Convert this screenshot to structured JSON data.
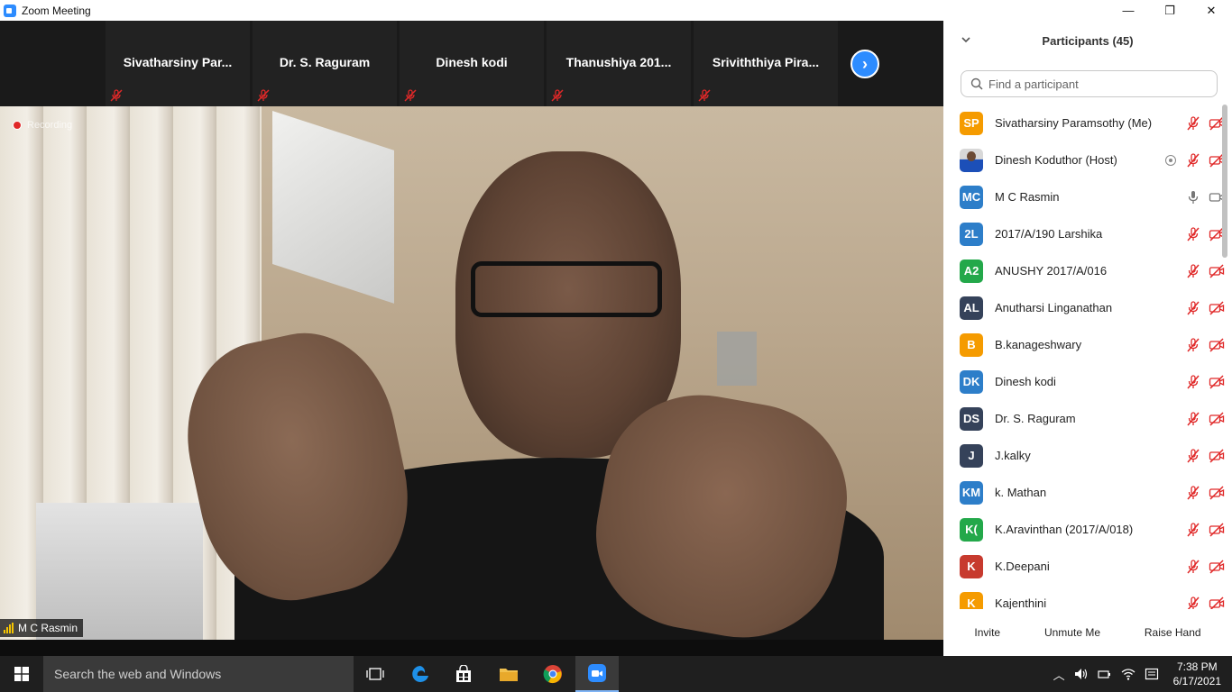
{
  "window": {
    "title": "Zoom Meeting",
    "minimize": "—",
    "maximize": "❐",
    "close": "✕"
  },
  "gallery": {
    "tiles": [
      {
        "name": "Sivatharsiny  Par..."
      },
      {
        "name": "Dr. S. Raguram"
      },
      {
        "name": "Dinesh kodi"
      },
      {
        "name": "Thanushiya  201..."
      },
      {
        "name": "Sriviththiya  Pira..."
      }
    ],
    "next_glyph": "›"
  },
  "main": {
    "recording_text": "Recording",
    "speaker_name": "M C Rasmin"
  },
  "panel": {
    "title": "Participants (45)",
    "search_placeholder": "Find a participant",
    "participants": [
      {
        "initials": "SP",
        "name": "Sivatharsiny Paramsothy (Me)",
        "color": "#f59b00",
        "mic": "muted",
        "video": "off"
      },
      {
        "initials": "",
        "name": "Dinesh Koduthor (Host)",
        "color": "photo",
        "mic": "muted",
        "video": "off",
        "host": true
      },
      {
        "initials": "MC",
        "name": "M C Rasmin",
        "color": "#2d7ec9",
        "mic": "on",
        "video": "on"
      },
      {
        "initials": "2L",
        "name": "2017/A/190 Larshika",
        "color": "#2d7ec9",
        "mic": "muted",
        "video": "off"
      },
      {
        "initials": "A2",
        "name": "ANUSHY 2017/A/016",
        "color": "#23a84a",
        "mic": "muted",
        "video": "off"
      },
      {
        "initials": "AL",
        "name": "Anutharsi Linganathan",
        "color": "#35425a",
        "mic": "muted",
        "video": "off"
      },
      {
        "initials": "B",
        "name": "B.kanageshwary",
        "color": "#f59b00",
        "mic": "muted",
        "video": "off"
      },
      {
        "initials": "DK",
        "name": "Dinesh kodi",
        "color": "#2d7ec9",
        "mic": "muted",
        "video": "off"
      },
      {
        "initials": "DS",
        "name": "Dr. S. Raguram",
        "color": "#35425a",
        "mic": "muted",
        "video": "off"
      },
      {
        "initials": "J",
        "name": "J.kalky",
        "color": "#35425a",
        "mic": "muted",
        "video": "off"
      },
      {
        "initials": "KM",
        "name": "k. Mathan",
        "color": "#2d7ec9",
        "mic": "muted",
        "video": "off"
      },
      {
        "initials": "K(",
        "name": "K.Aravinthan (2017/A/018)",
        "color": "#23a84a",
        "mic": "muted",
        "video": "off"
      },
      {
        "initials": "K",
        "name": "K.Deepani",
        "color": "#c73a2e",
        "mic": "muted",
        "video": "off"
      },
      {
        "initials": "K",
        "name": "Kajenthini",
        "color": "#f59b00",
        "mic": "muted",
        "video": "off"
      }
    ],
    "footer": {
      "invite": "Invite",
      "unmute": "Unmute Me",
      "raise_hand": "Raise Hand"
    }
  },
  "taskbar": {
    "search_text": "Search the web and Windows",
    "time": "7:38 PM",
    "date": "6/17/2021"
  },
  "colors": {
    "zoom_blue": "#2d8cff",
    "muted_red": "#e02828"
  }
}
